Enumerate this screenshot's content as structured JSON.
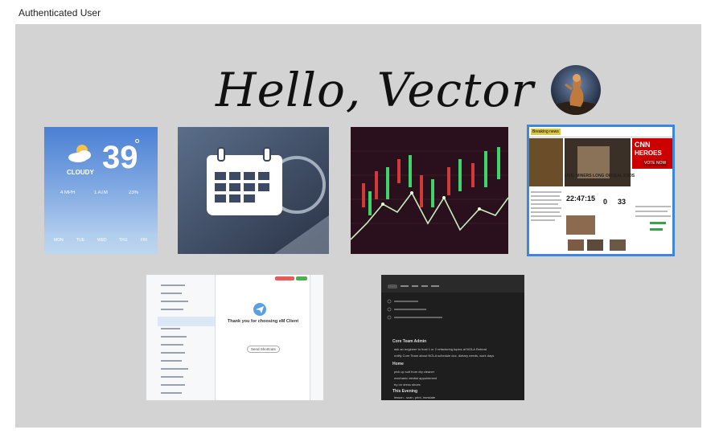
{
  "header": {
    "title": "Authenticated User"
  },
  "greeting": {
    "text": "Hello, Vector"
  },
  "tiles": {
    "weather": {
      "condition": "CLOUDY",
      "temperature": "39",
      "degree": "°",
      "wind": "4 MPH",
      "pressure": "1 ATM",
      "humidity": "23%",
      "days": [
        "MON",
        "TUE",
        "WED",
        "THU",
        "FRI"
      ]
    },
    "news": {
      "brand": "CNN",
      "heroes": "HEROES",
      "vote": "VOTE NOW",
      "ticker": "Breaking news",
      "headline": "LIVE: MINERS LONG ORDEAL ENDS",
      "clock": "22:47:15",
      "count_left": "0",
      "count_right": "33"
    },
    "mail": {
      "thanks": "Thank you for choosing eM Client",
      "button": "Send Shortcuts"
    },
    "tasks": {
      "sections": [
        "Core Team Admin",
        "Home",
        "This Evening"
      ],
      "items": [
        "ask an engineer to host 1 or 2 refactoring topics at NOLA Retreat",
        "notify Core Team about NOLA schedule doc, dietary needs, work days",
        "pick up suit from dry cleaner",
        "mechanic dentist appointment",
        "try on dress shoes",
        "lesson - scan, print, translate"
      ]
    }
  },
  "colors": {
    "stage": "#d3d3d3",
    "selection": "#3c87dc",
    "weather_top": "#4a7fd4",
    "weather_bottom": "#c6dcf2"
  }
}
